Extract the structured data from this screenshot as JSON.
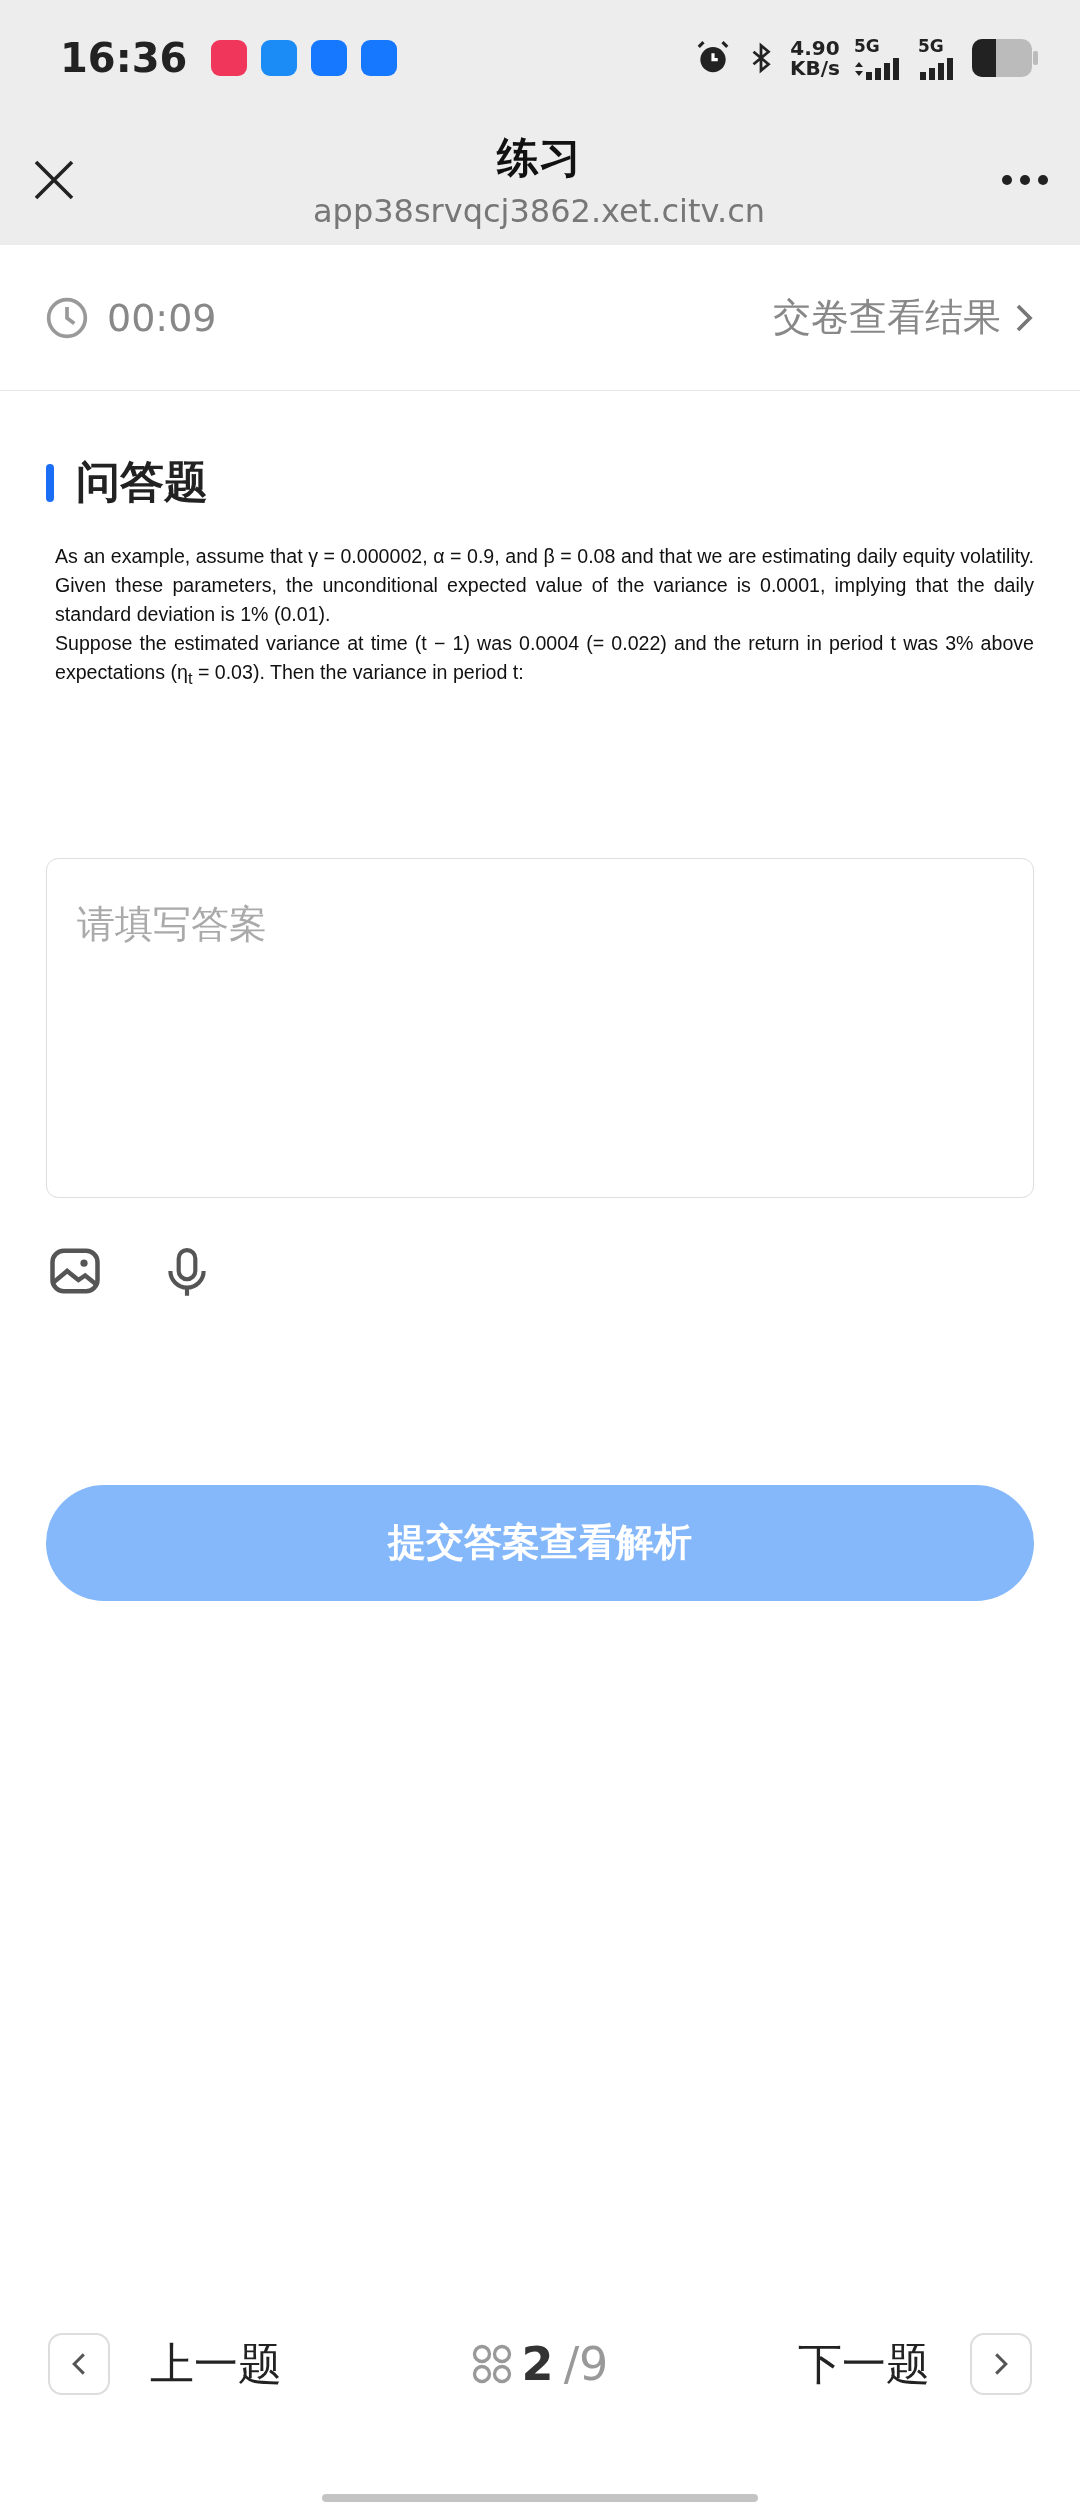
{
  "status_bar": {
    "time": "16:36",
    "network_speed": "4.90",
    "speed_unit": "KB/s",
    "network_1": "5G",
    "network_2": "5G",
    "app_icons": [
      {
        "color": "#f0365a"
      },
      {
        "color": "#1b8cf5"
      },
      {
        "color": "#1677ff"
      },
      {
        "color": "#1677ff"
      }
    ]
  },
  "header": {
    "title": "练习",
    "url": "app38srvqcj3862.xet.citv.cn"
  },
  "timer": {
    "time": "00:09",
    "submit_link": "交卷查看结果"
  },
  "question": {
    "type_label": "问答题",
    "paragraphs": [
      "As an example, assume that γ = 0.000002, α = 0.9, and β = 0.08 and that we are estimating daily equity volatility. Given these parameters, the unconditional expected value of the variance is 0.0001, implying that the daily standard deviation is 1% (0.01).",
      "Suppose the estimated variance at time (t − 1) was 0.0004 (= 0.022) and the return in period t was 3% above expectations (η$_{t}$ = 0.03). Then the variance in period t:"
    ]
  },
  "answer": {
    "placeholder": "请填写答案"
  },
  "submit_button": "提交答案查看解析",
  "bottom_nav": {
    "prev": "上一题",
    "current": "2",
    "total": "/9",
    "next": "下一题"
  }
}
